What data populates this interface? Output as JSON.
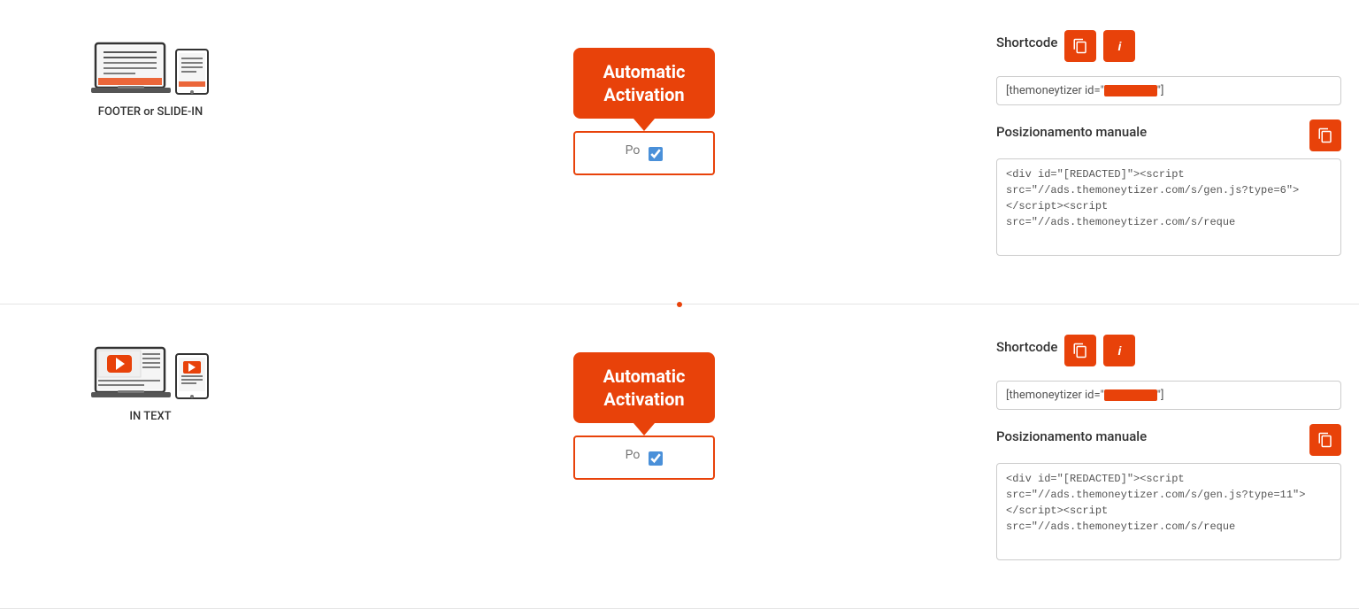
{
  "rows": [
    {
      "id": "footer-slide-in",
      "device_label": "FOOTER or SLIDE-IN",
      "tooltip_text": "Automatic\nActivation",
      "checkbox_checked": true,
      "position_label": "Po",
      "shortcode": {
        "title": "Shortcode",
        "value_prefix": "[themoneytizer id=\"",
        "value_suffix": "\"]"
      },
      "manual_position": {
        "title": "Posizionamento manuale",
        "code": "<div id=\"[REDACTED]\"><script src=\"//ads.themoneytizer.com/s/gen.js?type=6\"></script><script src=\"//ads.themoneytizer.com/s/reque"
      }
    },
    {
      "id": "in-text",
      "device_label": "IN TEXT",
      "tooltip_text": "Automatic\nActivation",
      "checkbox_checked": true,
      "position_label": "Po",
      "shortcode": {
        "title": "Shortcode",
        "value_prefix": "[themoneytizer id=\"",
        "value_suffix": "\"]"
      },
      "manual_position": {
        "title": "Posizionamento manuale",
        "code": "<div id=\"[REDACTED]\"><script src=\"//ads.themoneytizer.com/s/gen.js?type=11\"></script><script src=\"//ads.themoneytizer.com/s/reque"
      }
    }
  ],
  "buttons": {
    "copy_label": "📋",
    "info_label": "i"
  }
}
